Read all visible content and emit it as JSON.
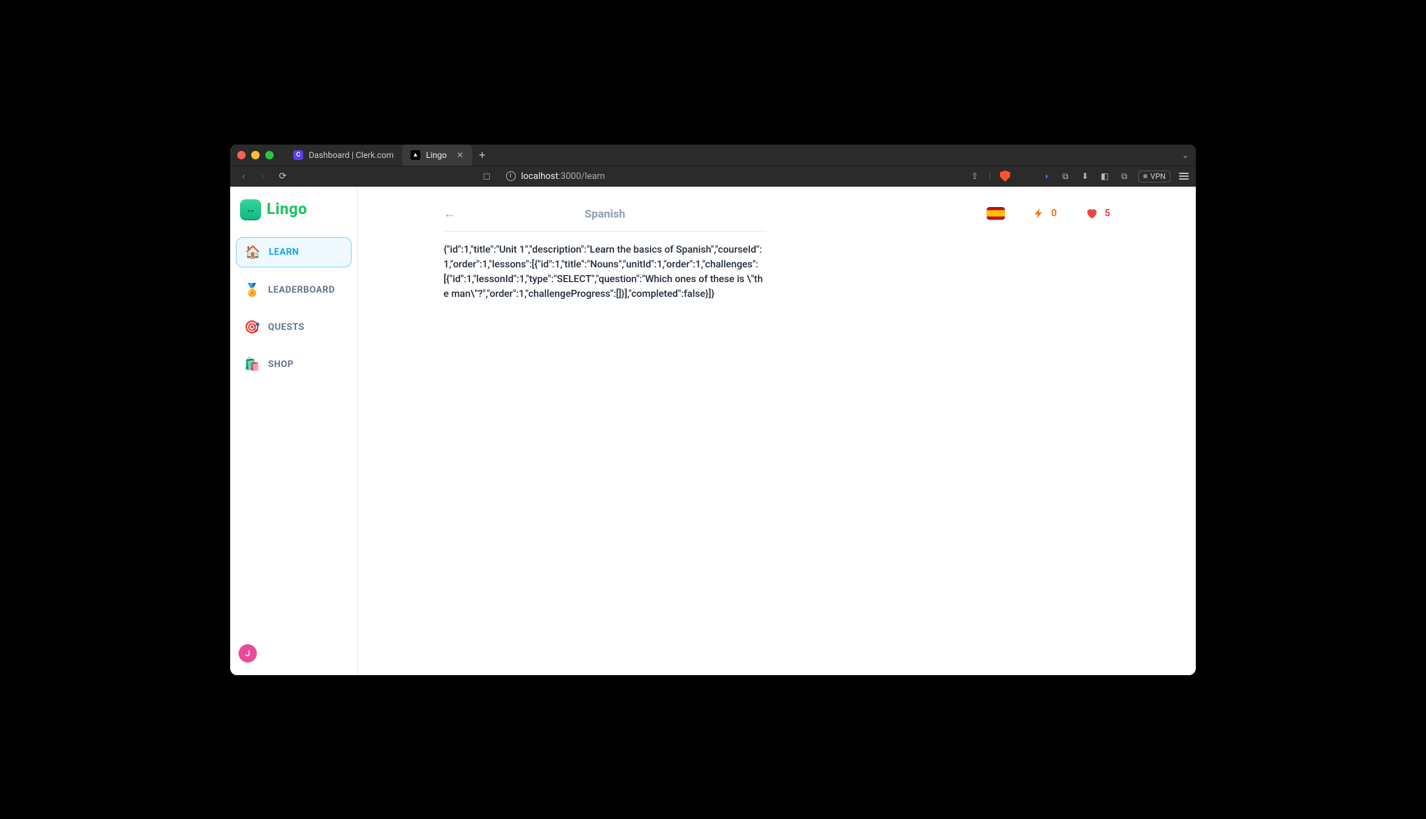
{
  "browser": {
    "tabs": [
      {
        "title": "Dashboard | Clerk.com",
        "favicon_letter": "C",
        "favicon_bg": "#5b3df5",
        "favicon_fg": "#fff",
        "active": false
      },
      {
        "title": "Lingo",
        "favicon_letter": "▲",
        "favicon_bg": "#000",
        "favicon_fg": "#fff",
        "active": true
      }
    ],
    "url_host": "localhost",
    "url_port": ":3000",
    "url_path": "/learn",
    "vpn_label": "VPN"
  },
  "app": {
    "brand": "Lingo",
    "logo_glyph": "↔",
    "nav": [
      {
        "label": "LEARN",
        "emoji": "🏠",
        "active": true
      },
      {
        "label": "LEADERBOARD",
        "emoji": "🏅",
        "active": false
      },
      {
        "label": "QUESTS",
        "emoji": "🎯",
        "active": false
      },
      {
        "label": "SHOP",
        "emoji": "🛍️",
        "active": false
      }
    ],
    "avatar_initial": "J"
  },
  "header": {
    "course_title": "Spanish"
  },
  "stats": {
    "points": "0",
    "hearts": "5"
  },
  "body_text": "{\"id\":1,\"title\":\"Unit 1\",\"description\":\"Learn the basics of Spanish\",\"courseId\":1,\"order\":1,\"lessons\":[{\"id\":1,\"title\":\"Nouns\",\"unitId\":1,\"order\":1,\"challenges\":[{\"id\":1,\"lessonId\":1,\"type\":\"SELECT\",\"question\":\"Which ones of these is \\\"the man\\\"?\",\"order\":1,\"challengeProgress\":[]}],\"completed\":false}]}"
}
